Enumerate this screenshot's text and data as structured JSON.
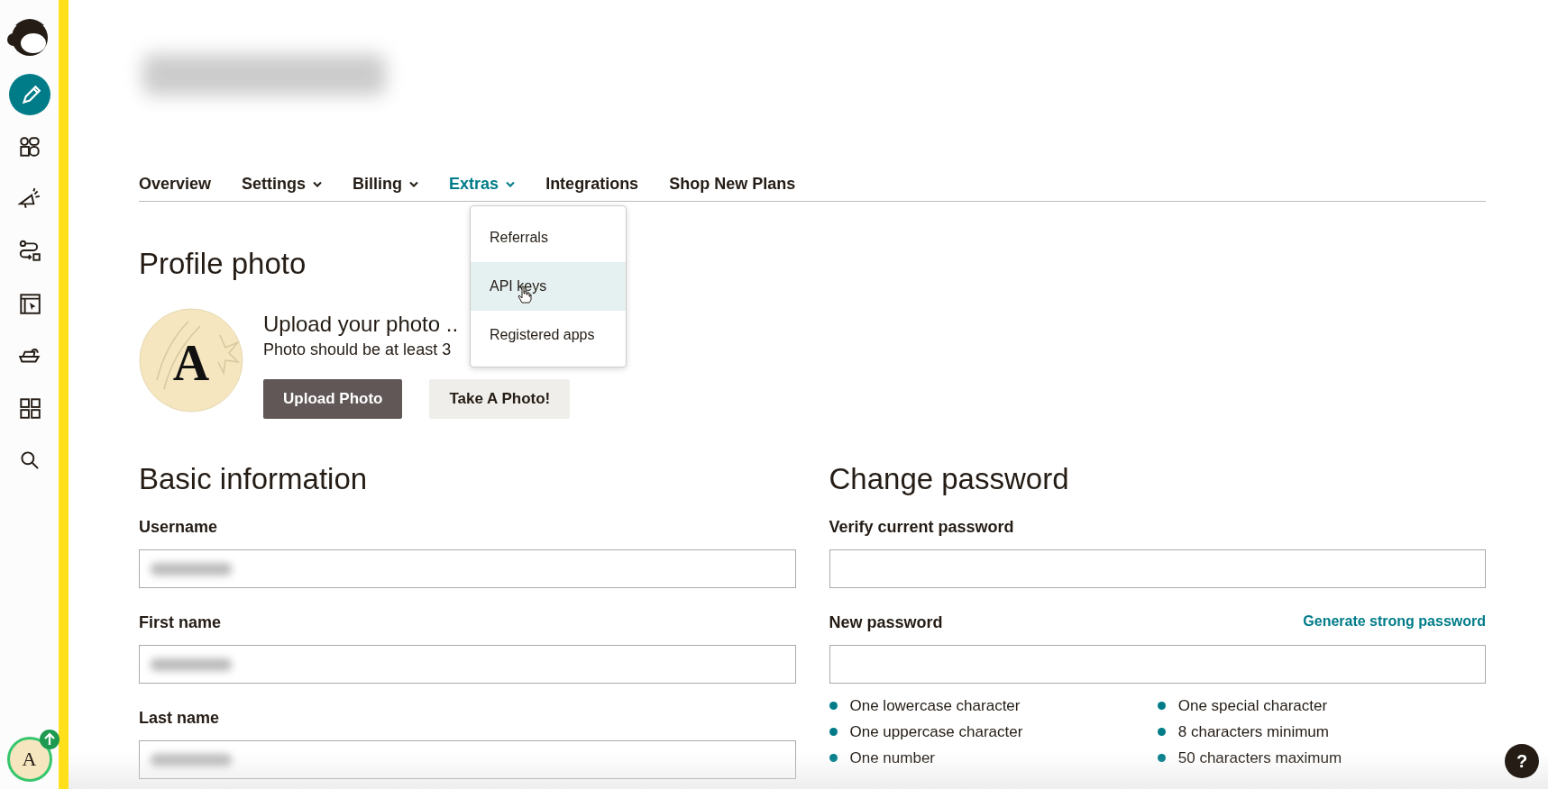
{
  "sidebar": {
    "items": [
      {
        "kind": "create",
        "selected": true
      },
      {
        "kind": "audience",
        "selected": false
      },
      {
        "kind": "campaigns",
        "selected": false
      },
      {
        "kind": "automations",
        "selected": false
      },
      {
        "kind": "website",
        "selected": false
      },
      {
        "kind": "content",
        "selected": false
      },
      {
        "kind": "integrations",
        "selected": false
      },
      {
        "kind": "search",
        "selected": false
      }
    ],
    "account": {
      "initial": "A",
      "upgrade_badge": true
    }
  },
  "header": {
    "title_redacted": true
  },
  "tabs": [
    {
      "label": "Overview",
      "has_menu": false,
      "selected": false
    },
    {
      "label": "Settings",
      "has_menu": true,
      "selected": false
    },
    {
      "label": "Billing",
      "has_menu": true,
      "selected": false
    },
    {
      "label": "Extras",
      "has_menu": true,
      "selected": true
    },
    {
      "label": "Integrations",
      "has_menu": false,
      "selected": false
    },
    {
      "label": "Shop New Plans",
      "has_menu": false,
      "selected": false
    }
  ],
  "extras_menu": {
    "items": [
      {
        "label": "Referrals",
        "selected": false
      },
      {
        "label": "API keys",
        "selected": true
      },
      {
        "label": "Registered apps",
        "selected": false
      }
    ]
  },
  "profile_photo": {
    "heading": "Profile photo",
    "avatar_initial": "A",
    "title": "Upload your photo ..",
    "hint": "Photo should be at least 3",
    "buttons": [
      {
        "label": "Upload Photo",
        "kind": "primary"
      },
      {
        "label": "Take A Photo!",
        "kind": "secondary"
      }
    ]
  },
  "basic_information": {
    "heading": "Basic information",
    "fields": [
      {
        "label": "Username",
        "redacted": true
      },
      {
        "label": "First name",
        "redacted": true
      },
      {
        "label": "Last name",
        "redacted": true
      }
    ]
  },
  "change_password": {
    "heading": "Change password",
    "fields": [
      {
        "label": "Verify current password",
        "redacted": false
      },
      {
        "label": "New password",
        "redacted": false,
        "link": "Generate strong password"
      }
    ],
    "rules": [
      "One lowercase character",
      "One uppercase character",
      "One number",
      "One special character",
      "8 characters minimum",
      "50 characters maximum"
    ]
  },
  "help_button": {
    "label": "?"
  }
}
